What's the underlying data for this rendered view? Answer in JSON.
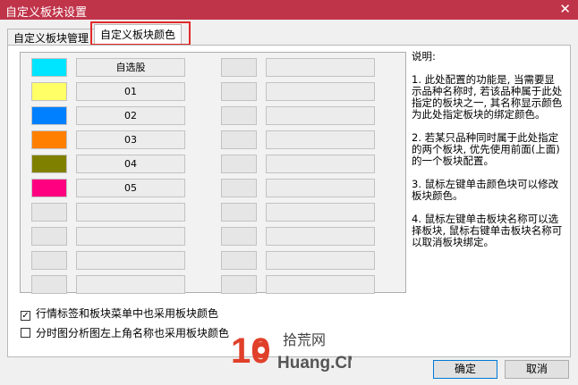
{
  "window": {
    "title": "自定义板块设置",
    "close_glyph": "✕"
  },
  "tabs": [
    {
      "label": "自定义板块管理",
      "active": false
    },
    {
      "label": "自定义板块颜色",
      "active": true
    }
  ],
  "left_rows": [
    {
      "color": "#00e5ff",
      "name": "自选股"
    },
    {
      "color": "#ffff66",
      "name": "01"
    },
    {
      "color": "#0080ff",
      "name": "02"
    },
    {
      "color": "#ff8000",
      "name": "03"
    },
    {
      "color": "#808000",
      "name": "04"
    },
    {
      "color": "#ff0080",
      "name": "05"
    },
    {
      "color": "#e6e6e6",
      "name": ""
    },
    {
      "color": "#e6e6e6",
      "name": ""
    },
    {
      "color": "#e6e6e6",
      "name": ""
    },
    {
      "color": "#e6e6e6",
      "name": ""
    }
  ],
  "right_rows": [
    {
      "color": "#e6e6e6",
      "name": ""
    },
    {
      "color": "#e6e6e6",
      "name": ""
    },
    {
      "color": "#e6e6e6",
      "name": ""
    },
    {
      "color": "#e6e6e6",
      "name": ""
    },
    {
      "color": "#e6e6e6",
      "name": ""
    },
    {
      "color": "#e6e6e6",
      "name": ""
    },
    {
      "color": "#e6e6e6",
      "name": ""
    },
    {
      "color": "#e6e6e6",
      "name": ""
    },
    {
      "color": "#e6e6e6",
      "name": ""
    },
    {
      "color": "#e6e6e6",
      "name": ""
    }
  ],
  "explanation": {
    "heading": "说明:",
    "paragraphs": [
      "1. 此处配置的功能是, 当需要显示品种名称时, 若该品种属于此处指定的板块之一, 其名称显示颜色为此处指定板块的绑定颜色。",
      "2. 若某只品种同时属于此处指定的两个板块, 优先使用前面(上面)的一个板块配置。",
      "3. 鼠标左键单击颜色块可以修改板块颜色。",
      "4. 鼠标左键单击板块名称可以选择板块, 鼠标右键单击板块名称可以取消板块绑定。"
    ]
  },
  "options": [
    {
      "label": "行情标签和板块菜单中也采用板块颜色",
      "checked": true
    },
    {
      "label": "分时图分析图左上角名称也采用板块颜色",
      "checked": false
    }
  ],
  "watermark": {
    "number": "10",
    "brand": "拾荒网",
    "site": "Huang.CN"
  },
  "buttons": {
    "ok": "确定",
    "cancel": "取消"
  }
}
